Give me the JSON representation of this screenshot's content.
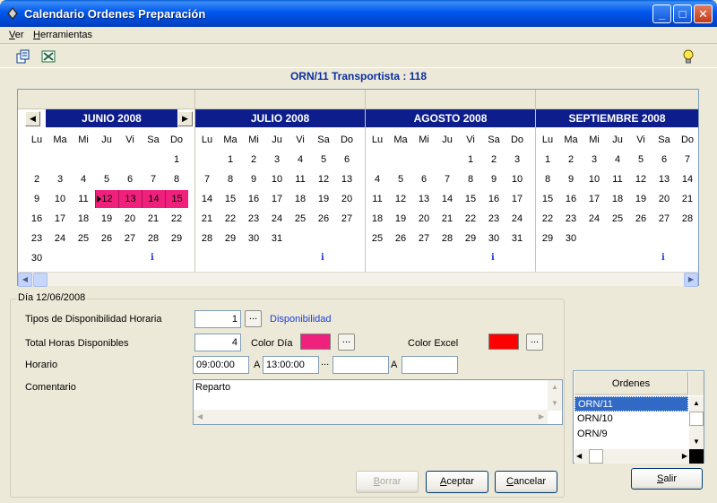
{
  "window": {
    "title": "Calendario Ordenes Preparación",
    "minimize": "_",
    "maximize": "□",
    "close": "✕"
  },
  "menu": {
    "ver_u": "V",
    "ver_rest": "er",
    "herr_u": "H",
    "herr_rest": "erramientas"
  },
  "toolbar": {
    "icons": [
      "copy-calendar-icon",
      "excel-export-icon",
      "lightbulb-icon"
    ]
  },
  "header": {
    "order_line": "ORN/11  Transportista : 118"
  },
  "calendar": {
    "weekdays": [
      "Lu",
      "Ma",
      "Mi",
      "Ju",
      "Vi",
      "Sa",
      "Do"
    ],
    "info_glyph": "i",
    "months": [
      {
        "title": "JUNIO 2008",
        "first_weekday": 6,
        "days": 30,
        "selected": [
          12,
          13,
          14,
          15
        ],
        "info_row": 5
      },
      {
        "title": "JULIO 2008",
        "first_weekday": 1,
        "days": 31,
        "selected": [],
        "info_row": 5
      },
      {
        "title": "AGOSTO 2008",
        "first_weekday": 4,
        "days": 31,
        "selected": [],
        "info_row": 5
      },
      {
        "title": "SEPTIEMBRE 2008",
        "first_weekday": 0,
        "days": 30,
        "selected": [],
        "info_row": 5
      }
    ],
    "selected_color": "#f0207d",
    "month_title_bg": "#0d1e8c"
  },
  "day_panel": {
    "legend": "Día 12/06/2008",
    "tipos_label": "Tipos de Disponibilidad Horaria",
    "tipos_value": "1",
    "tipos_link": "Disponibilidad",
    "horas_label": "Total Horas Disponibles",
    "horas_value": "4",
    "color_dia_label": "Color Día",
    "color_dia": "#f0207d",
    "color_excel_label": "Color Excel",
    "color_excel": "#ff0000",
    "horario_label": "Horario",
    "horario_desde": "09:00:00",
    "a1": "A",
    "horario_hasta": "13:00:00",
    "ellipsis": "...",
    "horario_desde2": "",
    "a2": "A",
    "horario_hasta2": "",
    "comentario_label": "Comentario",
    "comentario": "Reparto"
  },
  "buttons": {
    "borrar_u": "B",
    "borrar_rest": "orrar",
    "aceptar_u": "A",
    "aceptar_rest": "ceptar",
    "cancelar_u": "C",
    "cancelar_rest": "ancelar",
    "salir_u": "S",
    "salir_rest": "alir"
  },
  "orders": {
    "header": "Ordenes",
    "rows": [
      "ORN/11",
      "ORN/10",
      "ORN/9"
    ],
    "selected_index": 0
  }
}
